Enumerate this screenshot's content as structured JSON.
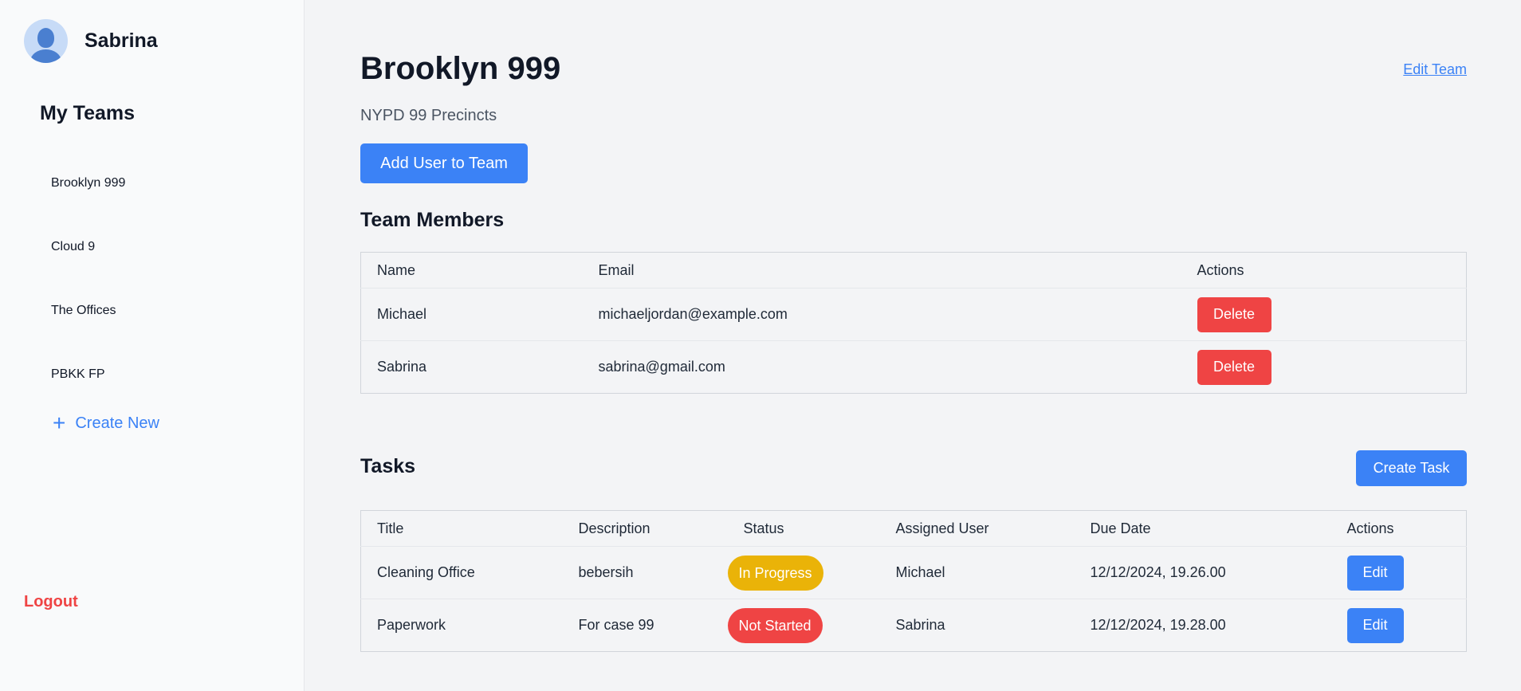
{
  "sidebar": {
    "user_name": "Sabrina",
    "teams_heading": "My Teams",
    "teams": [
      {
        "label": "Brooklyn 999"
      },
      {
        "label": "Cloud 9"
      },
      {
        "label": "The Offices"
      },
      {
        "label": "PBKK FP"
      }
    ],
    "create_new_label": "Create New",
    "logout_label": "Logout"
  },
  "team": {
    "name": "Brooklyn 999",
    "description": "NYPD 99 Precincts",
    "edit_label": "Edit Team",
    "add_user_label": "Add User to Team"
  },
  "members": {
    "heading": "Team Members",
    "columns": [
      "Name",
      "Email",
      "Actions"
    ],
    "rows": [
      {
        "name": "Michael",
        "email": "michaeljordan@example.com",
        "action": "Delete"
      },
      {
        "name": "Sabrina",
        "email": "sabrina@gmail.com",
        "action": "Delete"
      }
    ]
  },
  "tasks": {
    "heading": "Tasks",
    "create_label": "Create Task",
    "columns": [
      "Title",
      "Description",
      "Status",
      "Assigned User",
      "Due Date",
      "Actions"
    ],
    "rows": [
      {
        "title": "Cleaning Office",
        "description": "bebersih",
        "status": "In Progress",
        "assigned": "Michael",
        "due": "12/12/2024, 19.26.00",
        "action": "Edit"
      },
      {
        "title": "Paperwork",
        "description": "For case 99",
        "status": "Not Started",
        "assigned": "Sabrina",
        "due": "12/12/2024, 19.28.00",
        "action": "Edit"
      }
    ]
  },
  "colors": {
    "accent": "#3b82f6",
    "danger": "#ef4444",
    "warning": "#eab308"
  }
}
